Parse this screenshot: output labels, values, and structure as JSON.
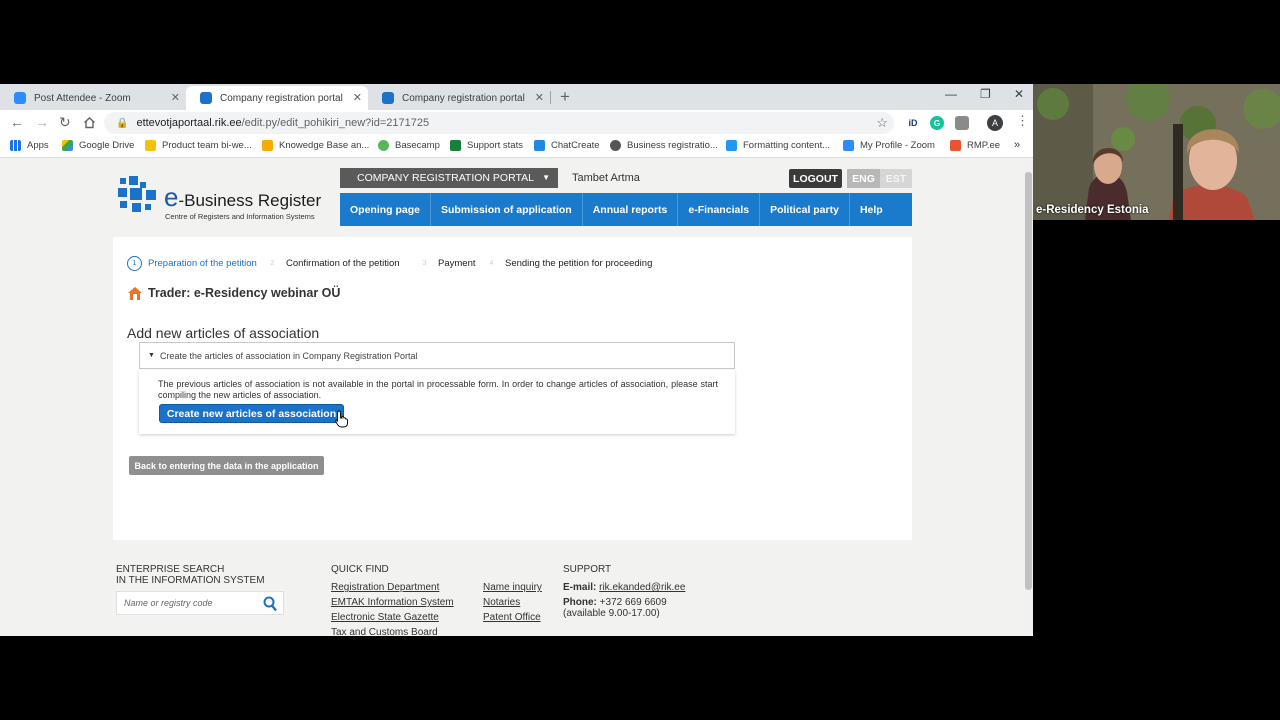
{
  "browser": {
    "tabs": [
      {
        "title": "Post Attendee - Zoom",
        "active": false
      },
      {
        "title": "Company registration portal",
        "active": true
      },
      {
        "title": "Company registration portal",
        "active": false
      }
    ],
    "url_domain": "ettevotjaportaal.rik.ee",
    "url_path": "/edit.py/edit_pohikiri_new?id=2171725",
    "profile_initial": "A",
    "extensions": {
      "id_label": "iD"
    },
    "bookmarks": [
      "Apps",
      "Google Drive",
      "Product team bi-we...",
      "Knowedge Base an...",
      "Basecamp",
      "Support stats",
      "ChatCreate",
      "Business registratio...",
      "Formatting content...",
      "My Profile - Zoom",
      "RMP.ee"
    ]
  },
  "site": {
    "logo_e": "e",
    "logo_title": "-Business Register",
    "logo_subtitle": "Centre of Registers and Information Systems",
    "portal_select": "COMPANY REGISTRATION PORTAL",
    "user_name": "Tambet Artma",
    "logout": "LOGOUT",
    "lang_eng": "ENG",
    "lang_est": "EST",
    "nav": [
      "Opening page",
      "Submission of application",
      "Annual reports",
      "e-Financials",
      "Political party",
      "Help"
    ]
  },
  "steps": [
    {
      "num": "1",
      "label": "Preparation of the petition"
    },
    {
      "num": "2",
      "label": "Confirmation of the petition"
    },
    {
      "num": "3",
      "label": "Payment"
    },
    {
      "num": "4",
      "label": "Sending the petition for proceeding"
    }
  ],
  "trader": "Trader: e-Residency webinar OÜ",
  "section_title": "Add new articles of association",
  "accordion": {
    "header": "Create the articles of association in Company Registration Portal",
    "text": "The previous articles of association is not available in the portal in processable form. In order to change articles of association, please start compiling the new articles of association.",
    "create_button": "Create new articles of association"
  },
  "back_button": "Back to entering the data in the application",
  "footer": {
    "enterprise_title_1": "ENTERPRISE SEARCH",
    "enterprise_title_2": "IN THE INFORMATION SYSTEM",
    "search_placeholder": "Name or registry code",
    "quickfind_title": "QUICK FIND",
    "quickfind_col1": [
      "Registration Department",
      "EMTAK Information System",
      "Electronic State Gazette",
      "Tax and Customs Board"
    ],
    "quickfind_col2": [
      "Name inquiry",
      "Notaries",
      "Patent Office"
    ],
    "support_title": "SUPPORT",
    "email_label": "E-mail:",
    "email": "rik.ekanded@rik.ee",
    "phone_label": "Phone:",
    "phone": "+372 669 6609",
    "hours": "(available 9.00-17.00)"
  },
  "video": {
    "label": "e-Residency Estonia"
  }
}
